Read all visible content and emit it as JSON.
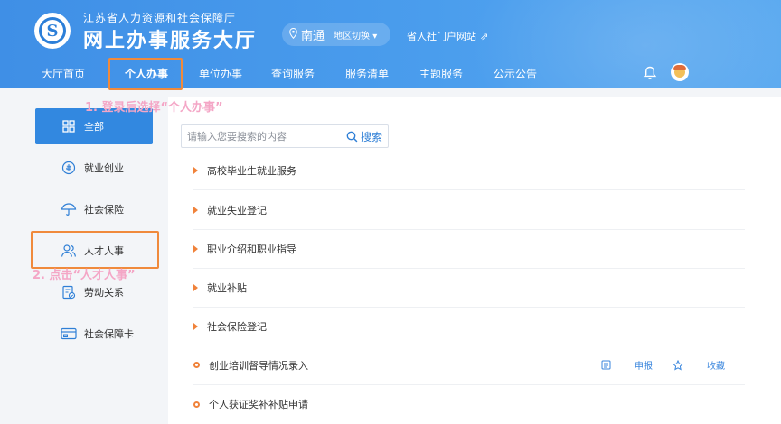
{
  "header": {
    "org_name": "江苏省人力资源和社会保障厅",
    "site_name": "网上办事服务大厅",
    "city": "南通",
    "region_switch": "地区切换 ▾",
    "portal_link": "省人社门户网站",
    "colors": {
      "header_blue": "#4a9ded",
      "accent": "#f08a3c"
    }
  },
  "nav": {
    "items": [
      {
        "label": "大厅首页"
      },
      {
        "label": "个人办事",
        "active": true
      },
      {
        "label": "单位办事"
      },
      {
        "label": "查询服务"
      },
      {
        "label": "服务清单"
      },
      {
        "label": "主题服务"
      },
      {
        "label": "公示公告"
      }
    ],
    "icons": [
      "bell-icon",
      "avatar"
    ]
  },
  "annotations": {
    "step1": "1. 登录后选择“个人办事”",
    "step2": "2. 点击“人才人事”"
  },
  "sidebar": {
    "items": [
      {
        "label": "全部",
        "icon": "grid-icon",
        "active": true
      },
      {
        "label": "就业创业",
        "icon": "hand-coin-icon"
      },
      {
        "label": "社会保险",
        "icon": "umbrella-icon"
      },
      {
        "label": "人才人事",
        "icon": "people-icon"
      },
      {
        "label": "劳动关系",
        "icon": "document-badge-icon"
      },
      {
        "label": "社会保障卡",
        "icon": "card-icon"
      }
    ]
  },
  "search": {
    "placeholder": "请输入您要搜索的内容",
    "button": "搜索"
  },
  "services": {
    "items": [
      {
        "label": "高校毕业生就业服务",
        "marker": "triangle"
      },
      {
        "label": "就业失业登记",
        "marker": "triangle"
      },
      {
        "label": "职业介绍和职业指导",
        "marker": "triangle"
      },
      {
        "label": "就业补贴",
        "marker": "triangle"
      },
      {
        "label": "社会保险登记",
        "marker": "triangle"
      },
      {
        "label": "创业培训督导情况录入",
        "marker": "ring",
        "apply": "申报",
        "favorite": "收藏"
      },
      {
        "label": "个人获证奖补补贴申请",
        "marker": "ring"
      }
    ]
  }
}
